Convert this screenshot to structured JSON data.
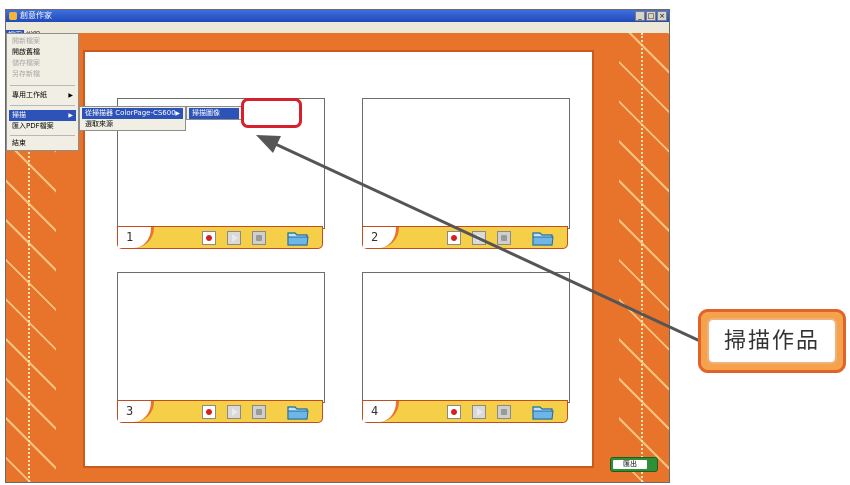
{
  "window": {
    "title": "創意作家",
    "buttons": [
      "_",
      "□",
      "×"
    ]
  },
  "menubar": {
    "items": [
      "檔案",
      "說明"
    ]
  },
  "file_menu": {
    "items": [
      {
        "label": "開新檔案",
        "disabled": true
      },
      {
        "label": "開啟舊檔",
        "disabled": false
      },
      {
        "label": "儲存檔案",
        "disabled": true
      },
      {
        "label": "另存新檔",
        "disabled": true
      },
      {
        "label": "專用工作紙",
        "disabled": false,
        "submenu": true
      },
      {
        "label": "掃描",
        "disabled": false,
        "submenu": true,
        "active": true
      },
      {
        "label": "匯入PDF檔案",
        "disabled": false
      },
      {
        "label": "結束",
        "disabled": false
      }
    ]
  },
  "scan_submenu": {
    "items": [
      {
        "label": "從掃描器 ColorPage-CS600",
        "active": true,
        "submenu": true
      },
      {
        "label": "選取來源",
        "active": false
      }
    ]
  },
  "scanner_submenu": {
    "items": [
      {
        "label": "掃描圖像",
        "active": true
      }
    ]
  },
  "slots": [
    {
      "number": "1"
    },
    {
      "number": "2"
    },
    {
      "number": "3"
    },
    {
      "number": "4"
    }
  ],
  "controls": {
    "icons": [
      "record-icon",
      "play-icon",
      "delete-icon",
      "folder-icon"
    ]
  },
  "export_button": {
    "label": "匯出"
  },
  "callout": {
    "text": "掃描作品"
  },
  "colors": {
    "frame_orange": "#e8742c",
    "bar_yellow": "#f6cf48",
    "menu_highlight": "#2d53b8",
    "annotation_red": "#d81f2c",
    "callout_orange": "#f6a24d"
  }
}
